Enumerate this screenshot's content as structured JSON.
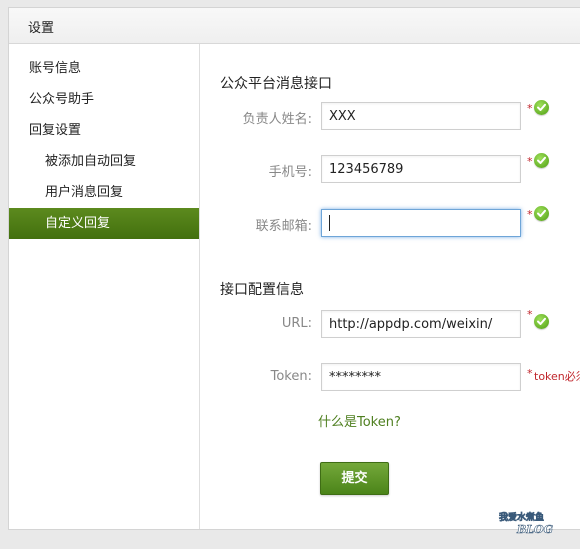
{
  "header": {
    "title": "设置"
  },
  "sidebar": {
    "items": [
      {
        "label": "账号信息"
      },
      {
        "label": "公众号助手"
      },
      {
        "label": "回复设置"
      },
      {
        "label": "被添加自动回复"
      },
      {
        "label": "用户消息回复"
      },
      {
        "label": "自定义回复"
      }
    ]
  },
  "form": {
    "section1_title": "公众平台消息接口",
    "section2_title": "接口配置信息",
    "name": {
      "label": "负责人姓名:",
      "value": "XXX"
    },
    "phone": {
      "label": "手机号:",
      "value": "123456789"
    },
    "email": {
      "label": "联系邮箱:",
      "value": ""
    },
    "url": {
      "label": "URL:",
      "value": "http://appdp.com/weixin/"
    },
    "token": {
      "label": "Token:",
      "value": "********",
      "error": "token必须"
    },
    "required_mark": "*",
    "help_link": "什么是Token?",
    "submit_label": "提交"
  },
  "watermark": {
    "text": "我爱水煮鱼 BLOG"
  },
  "colors": {
    "accent": "#4b8419",
    "error": "#c0262c",
    "focus": "#6ea5d8"
  }
}
